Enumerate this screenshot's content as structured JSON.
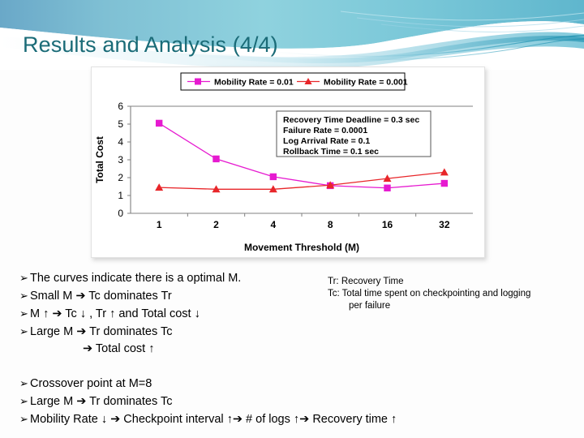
{
  "slide": {
    "title": "Results and Analysis (4/4)",
    "title_color": "#1a6b77",
    "background": "#fdfdfd"
  },
  "chart_data": {
    "type": "line",
    "title": "",
    "xlabel": "Movement Threshold (M)",
    "ylabel": "Total Cost",
    "categories": [
      "1",
      "2",
      "4",
      "8",
      "16",
      "32"
    ],
    "ylim": [
      0,
      6
    ],
    "yticks": [
      "0",
      "1",
      "2",
      "3",
      "4",
      "5",
      "6"
    ],
    "grid": false,
    "legend_position": "top",
    "series": [
      {
        "name": "Mobility Rate = 0.01",
        "color": "#e61ad0",
        "marker": "square",
        "values": [
          5.05,
          3.05,
          2.05,
          1.55,
          1.42,
          1.68
        ]
      },
      {
        "name": "Mobility Rate = 0.001",
        "color": "#e8262a",
        "marker": "triangle",
        "values": [
          1.45,
          1.35,
          1.35,
          1.58,
          1.95,
          2.3
        ]
      }
    ],
    "annotation": {
      "lines": [
        "Recovery Time Deadline = 0.3 sec",
        "Failure Rate = 0.0001",
        "Log Arrival Rate = 0.1",
        "Rollback Time = 0.1 sec"
      ]
    }
  },
  "bullets_top": [
    "The curves indicate there is a optimal M.",
    "Small M ➔ Tc dominates Tr",
    "M ↑ ➔ Tc ↓ , Tr ↑ and Total cost ↓",
    "Large M ➔ Tr dominates Tc"
  ],
  "bullets_top_indent": "➔ Total cost ↑",
  "bullets_bottom": [
    "Crossover point at M=8",
    "Large M ➔ Tr dominates Tc",
    "Mobility Rate ↓ ➔ Checkpoint interval ↑➔ # of logs ↑➔ Recovery time ↑"
  ],
  "definitions": {
    "line1": "Tr: Recovery Time",
    "line2": "Tc: Total time spent on checkpointing and logging",
    "line3": "per failure"
  },
  "bullet_glyph": "➢"
}
